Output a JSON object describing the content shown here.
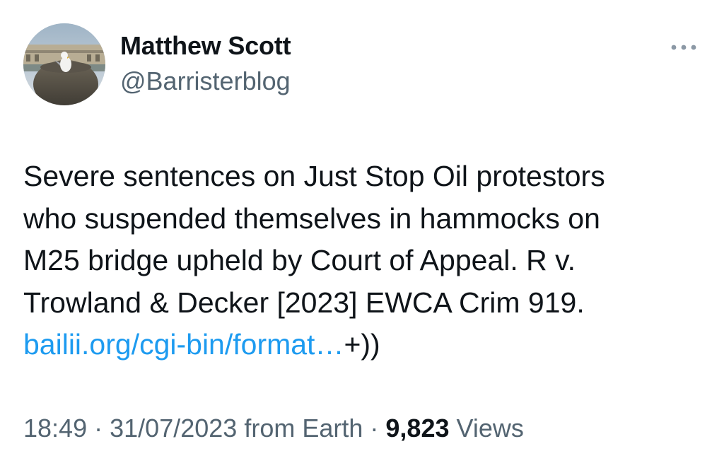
{
  "tweet": {
    "author": {
      "name": "Matthew Scott",
      "handle": "@Barristerblog"
    },
    "more_icon": "more-horizontal-icon",
    "text_lines": [
      "Severe sentences on Just Stop Oil protestors",
      "who suspended themselves in hammocks on",
      "M25 bridge upheld by Court of Appeal. R v.",
      "Trowland & Decker [2023] EWCA Crim 919."
    ],
    "link_text": "bailii.org/cgi-bin/format…",
    "link_suffix": "+))",
    "meta": {
      "time": "18:49",
      "separator": "·",
      "date": "31/07/2023",
      "source": "from Earth",
      "views_count": "9,823",
      "views_label": "Views"
    },
    "colors": {
      "link": "#1d9bf0",
      "secondary_text": "#536471",
      "primary_text": "#0f1419"
    }
  }
}
